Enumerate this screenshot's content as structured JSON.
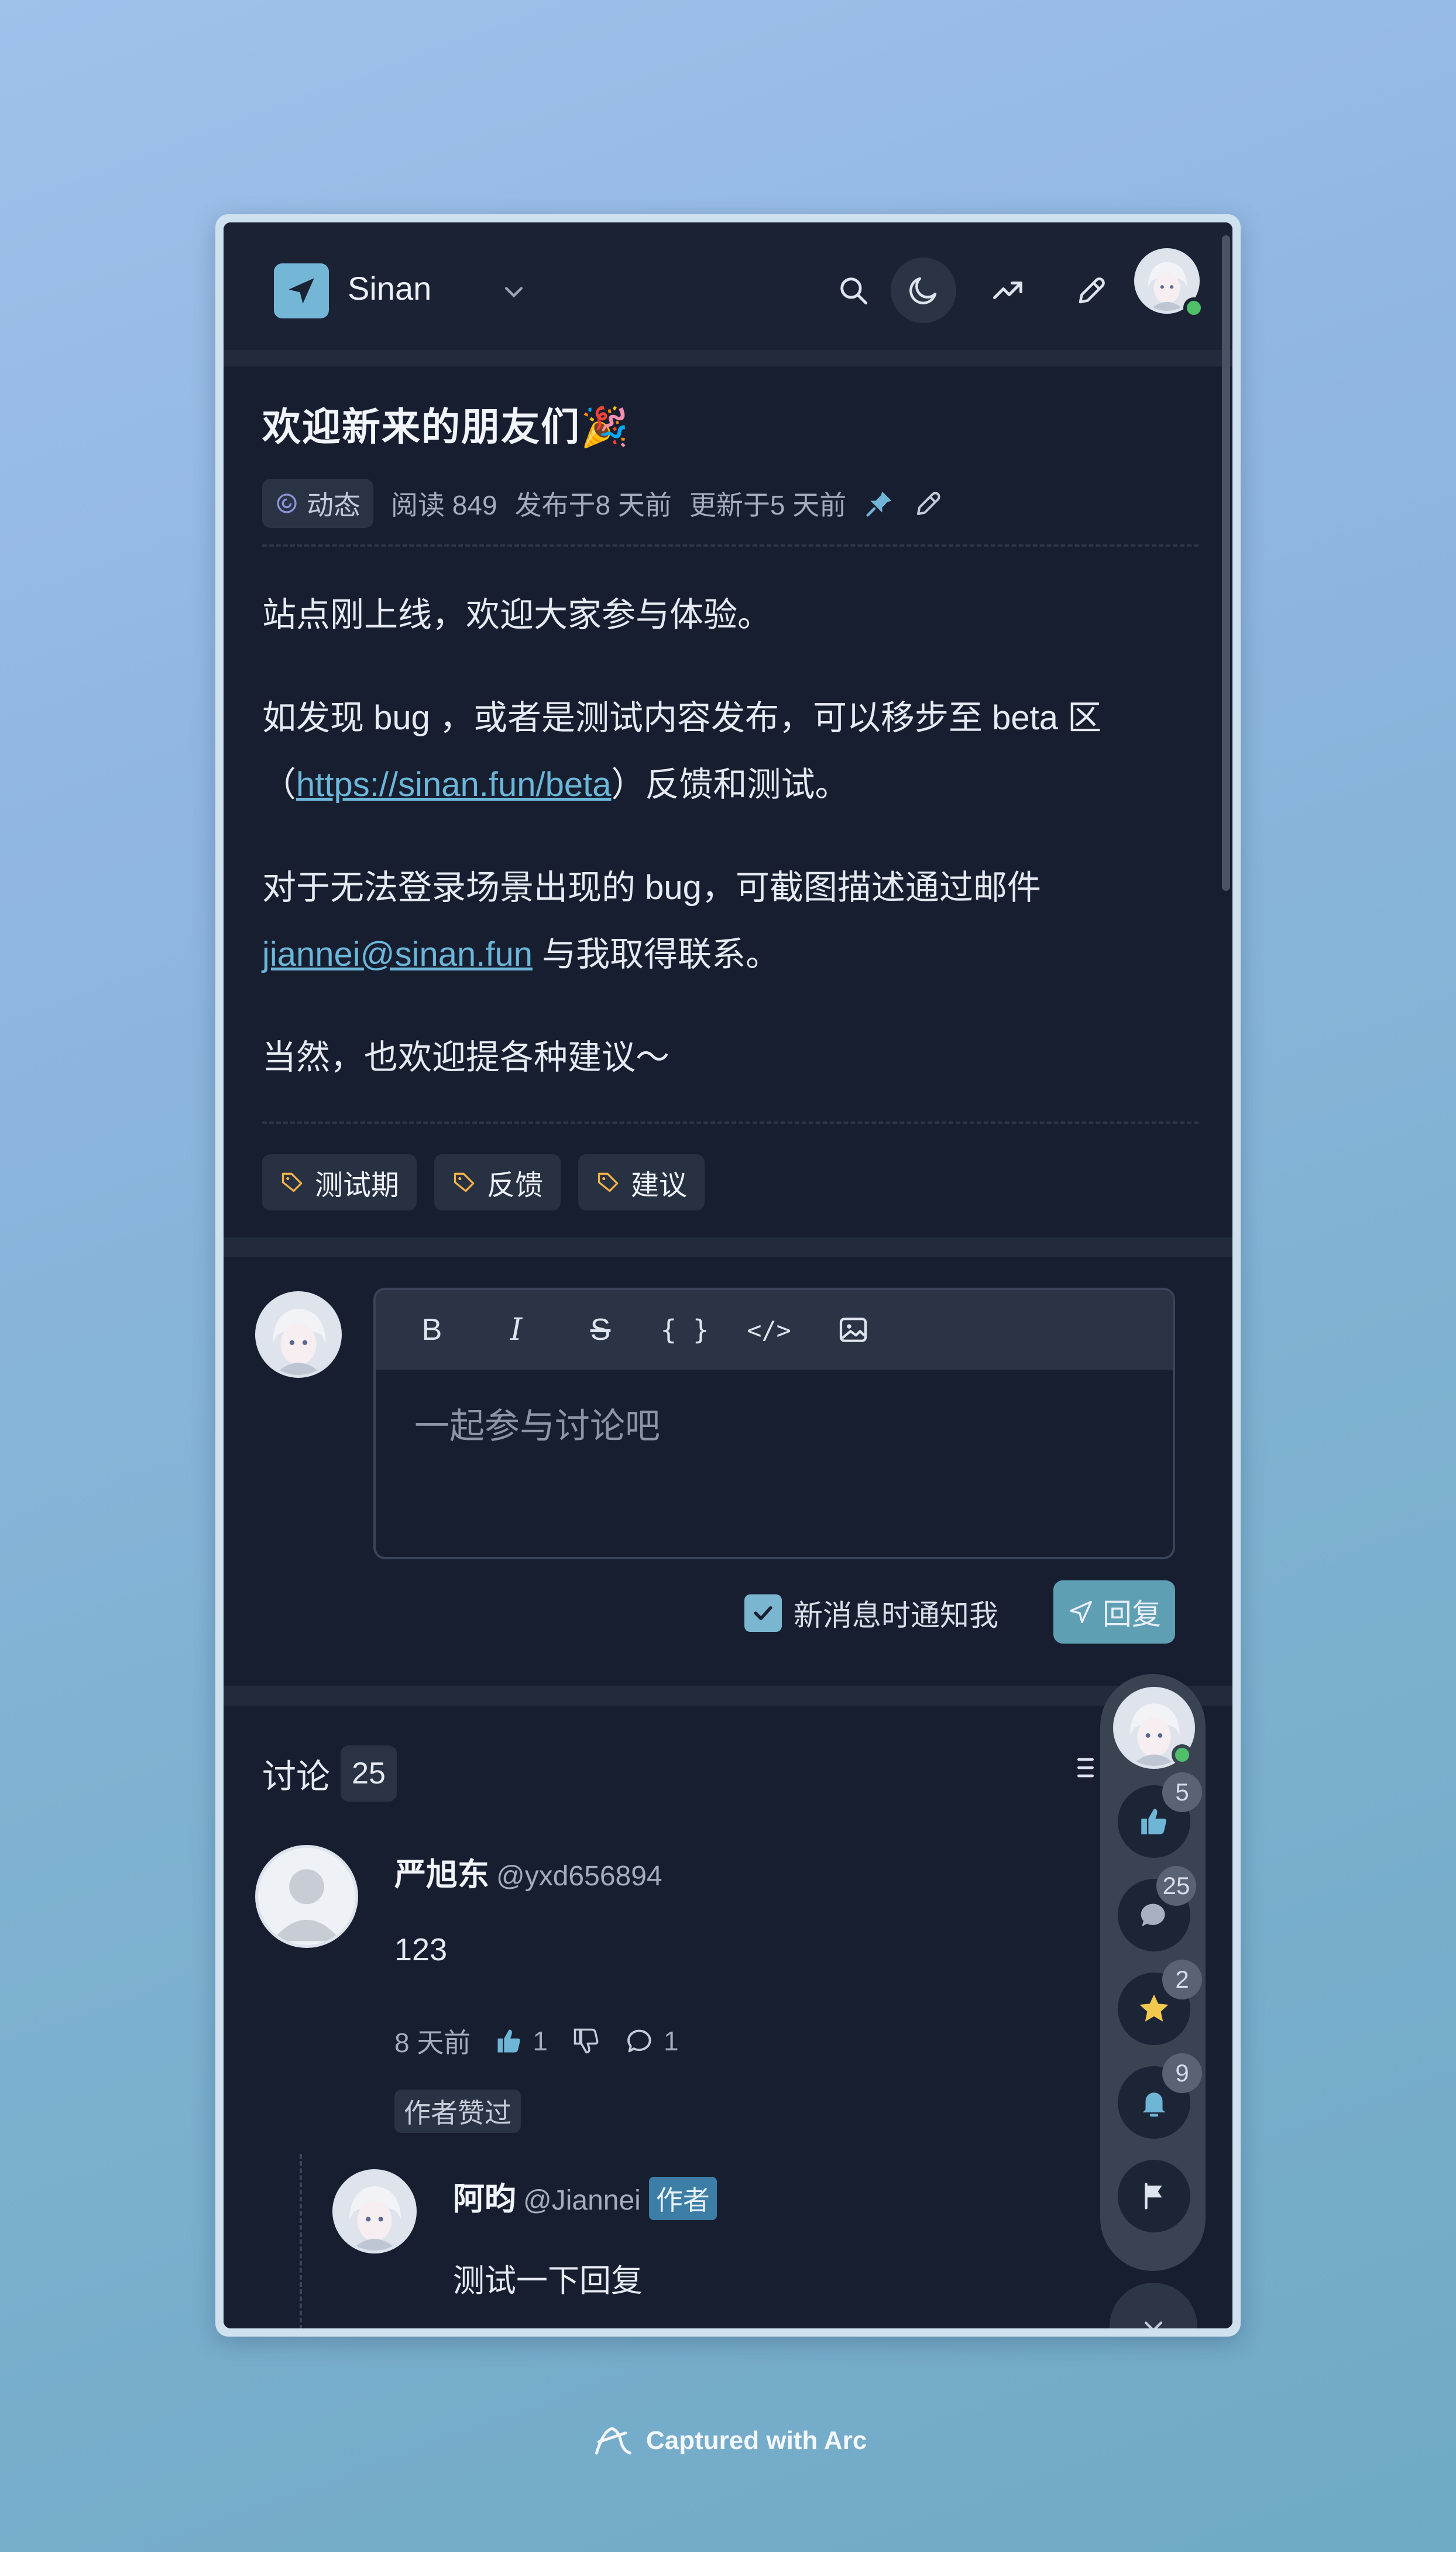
{
  "header": {
    "site_name": "Sinan",
    "icons": [
      "send-icon",
      "chevron-down-icon",
      "search-icon",
      "moon-icon",
      "trending-icon",
      "pen-icon",
      "gauge-icon",
      "bell-icon"
    ]
  },
  "post": {
    "title": "欢迎新来的朋友们🎉",
    "meta": {
      "category": "动态",
      "reads": "阅读 849",
      "published": "发布于8 天前",
      "updated": "更新于5 天前"
    },
    "paragraphs": {
      "p1": "站点刚上线，欢迎大家参与体验。",
      "p2_pre": "如发现 bug ，或者是测试内容发布，可以移步至 beta 区",
      "p2_open": "（",
      "p2_link": "https://sinan.fun/beta",
      "p2_post": "）反馈和测试。",
      "p3_pre": "对于无法登录场景出现的 bug，可截图描述通过邮件",
      "p3_link": "jiannei@sinan.fun",
      "p3_post": " 与我取得联系。",
      "p4": "当然，也欢迎提各种建议～"
    },
    "tags": [
      "测试期",
      "反馈",
      "建议"
    ]
  },
  "editor": {
    "toolbar": {
      "bold": "B",
      "italic": "I",
      "strike": "S",
      "code_block": "{ }",
      "code": "</>"
    },
    "placeholder": "一起参与讨论吧",
    "notify_label": "新消息时通知我",
    "notify_checked": true,
    "reply_label": "回复"
  },
  "discussion": {
    "title": "讨论",
    "count": "25",
    "comments": [
      {
        "name": "严旭东",
        "handle": "@yxd656894",
        "body": "123",
        "time": "8 天前",
        "likes": "1",
        "replies": "1",
        "author_liked": "作者赞过"
      }
    ],
    "reply": {
      "name": "阿昀",
      "handle": "@Jiannei",
      "badge": "作者",
      "body": "测试一下回复"
    }
  },
  "rail": {
    "likes": "5",
    "comments": "25",
    "stars": "2",
    "subscriptions": "9"
  },
  "footer": {
    "text": "Captured with Arc"
  },
  "colors": {
    "accent": "#74b6d6",
    "background": "#171e2f",
    "link": "#6bb7d9",
    "online": "#4fbf6a",
    "star": "#f2c94c"
  }
}
